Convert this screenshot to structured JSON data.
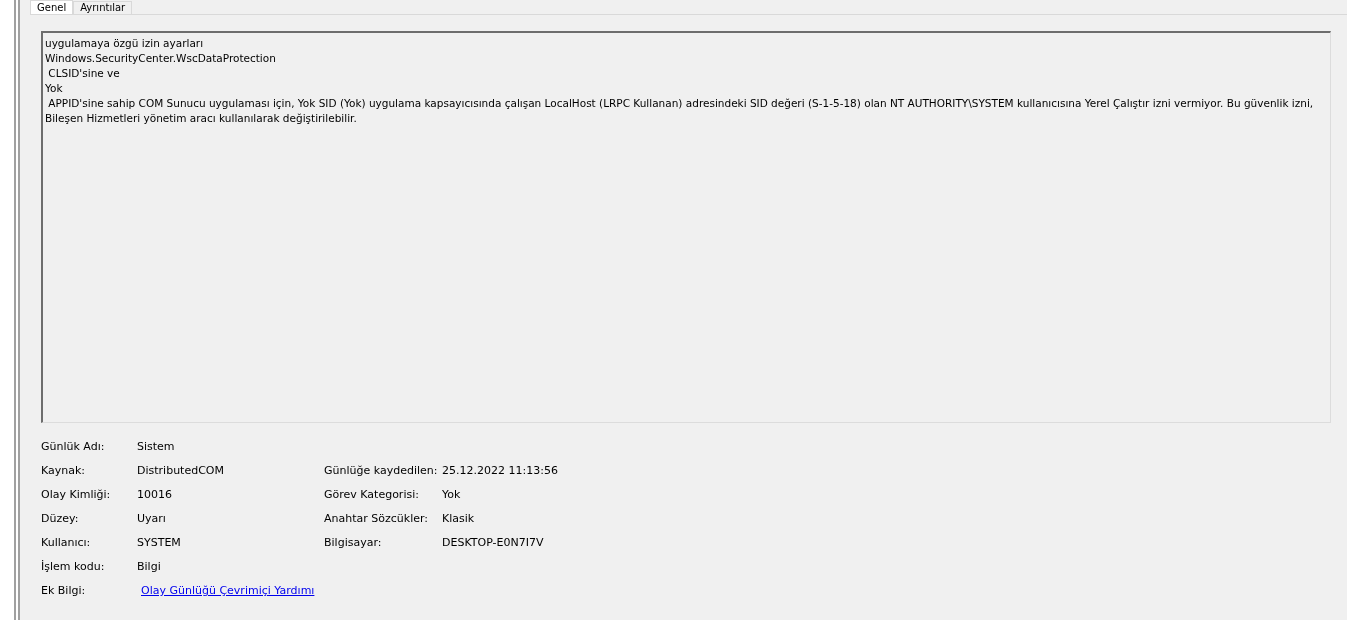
{
  "tabs": [
    {
      "label": "Genel",
      "selected": true
    },
    {
      "label": "Ayrıntılar",
      "selected": false
    }
  ],
  "message": "uygulamaya özgü izin ayarları\nWindows.SecurityCenter.WscDataProtection\n CLSID'sine ve\nYok\n APPID'sine sahip COM Sunucu uygulaması için, Yok SID (Yok) uygulama kapsayıcısında çalışan LocalHost (LRPC Kullanan) adresindeki SID değeri (S-1-5-18) olan NT AUTHORITY\\SYSTEM kullanıcısına Yerel Çalıştır izni vermiyor. Bu güvenlik izni, Bileşen Hizmetleri yönetim aracı kullanılarak değiştirilebilir.",
  "details": [
    {
      "label": "Günlük Adı:",
      "value": "Sistem"
    },
    {
      "label": "Kaynak:",
      "value": "DistributedCOM",
      "label_2": "Günlüğe kaydedilen:",
      "value_2": "25.12.2022 11:13:56"
    },
    {
      "label": "Olay Kimliği:",
      "value": "10016",
      "label_2": "Görev Kategorisi:",
      "value_2": "Yok"
    },
    {
      "label": "Düzey:",
      "value": "Uyarı",
      "label_2": "Anahtar Sözcükler:",
      "value_2": "Klasik"
    },
    {
      "label": "Kullanıcı:",
      "value": "SYSTEM",
      "label_2": "Bilgisayar:",
      "value_2": "DESKTOP-E0N7I7V"
    },
    {
      "label": "İşlem kodu:",
      "value": "Bilgi"
    },
    {
      "label": "Ek Bilgi:",
      "link": "Olay Günlüğü Çevrimiçi Yardımı"
    }
  ]
}
